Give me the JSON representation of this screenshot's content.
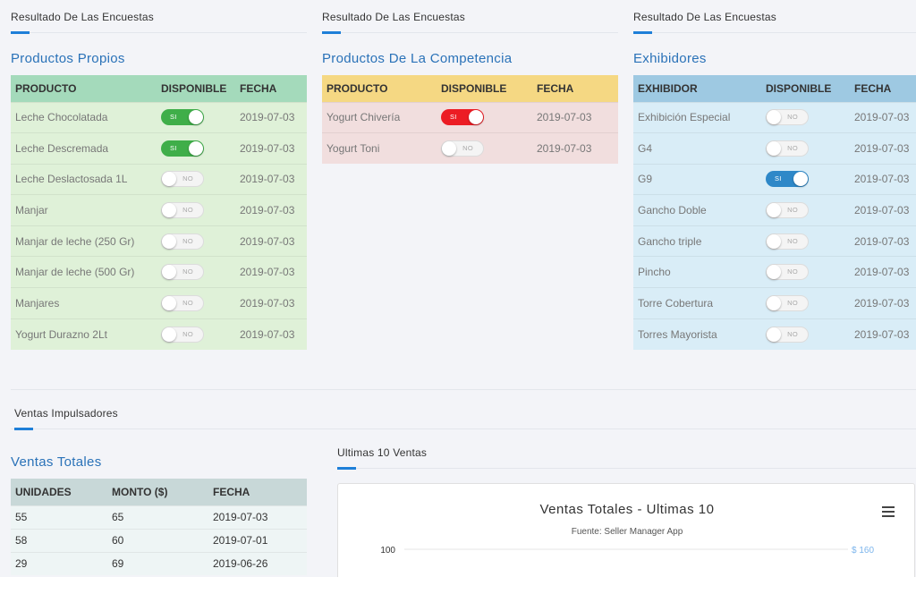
{
  "surveys": [
    {
      "section_title": "Resultado De Las Encuestas",
      "panel_title": "Productos Propios",
      "headers": [
        "PRODUCTO",
        "DISPONIBLE",
        "FECHA"
      ],
      "rows": [
        {
          "name": "Leche Chocolatada",
          "available": true,
          "toggle": "SI",
          "date": "2019-07-03"
        },
        {
          "name": "Leche Descremada",
          "available": true,
          "toggle": "SI",
          "date": "2019-07-03"
        },
        {
          "name": "Leche Deslactosada 1L",
          "available": false,
          "toggle": "NO",
          "date": "2019-07-03"
        },
        {
          "name": "Manjar",
          "available": false,
          "toggle": "NO",
          "date": "2019-07-03"
        },
        {
          "name": "Manjar de leche (250 Gr)",
          "available": false,
          "toggle": "NO",
          "date": "2019-07-03"
        },
        {
          "name": "Manjar de leche (500 Gr)",
          "available": false,
          "toggle": "NO",
          "date": "2019-07-03"
        },
        {
          "name": "Manjares",
          "available": false,
          "toggle": "NO",
          "date": "2019-07-03"
        },
        {
          "name": "Yogurt Durazno 2Lt",
          "available": false,
          "toggle": "NO",
          "date": "2019-07-03"
        }
      ]
    },
    {
      "section_title": "Resultado De Las Encuestas",
      "panel_title": "Productos De La Competencia",
      "headers": [
        "PRODUCTO",
        "DISPONIBLE",
        "FECHA"
      ],
      "rows": [
        {
          "name": "Yogurt Chivería",
          "available": true,
          "toggle": "SI",
          "date": "2019-07-03"
        },
        {
          "name": "Yogurt Toni",
          "available": false,
          "toggle": "NO",
          "date": "2019-07-03"
        }
      ]
    },
    {
      "section_title": "Resultado De Las Encuestas",
      "panel_title": "Exhibidores",
      "headers": [
        "EXHIBIDOR",
        "DISPONIBLE",
        "FECHA"
      ],
      "rows": [
        {
          "name": "Exhibición Especial",
          "available": false,
          "toggle": "NO",
          "date": "2019-07-03"
        },
        {
          "name": "G4",
          "available": false,
          "toggle": "NO",
          "date": "2019-07-03"
        },
        {
          "name": "G9",
          "available": true,
          "toggle": "SI",
          "date": "2019-07-03"
        },
        {
          "name": "Gancho Doble",
          "available": false,
          "toggle": "NO",
          "date": "2019-07-03"
        },
        {
          "name": "Gancho triple",
          "available": false,
          "toggle": "NO",
          "date": "2019-07-03"
        },
        {
          "name": "Pincho",
          "available": false,
          "toggle": "NO",
          "date": "2019-07-03"
        },
        {
          "name": "Torre Cobertura",
          "available": false,
          "toggle": "NO",
          "date": "2019-07-03"
        },
        {
          "name": "Torres Mayorista",
          "available": false,
          "toggle": "NO",
          "date": "2019-07-03"
        }
      ]
    }
  ],
  "sales": {
    "section_title": "Ventas Impulsadores",
    "panel_title": "Ventas Totales",
    "headers": [
      "UNIDADES",
      "MONTO ($)",
      "FECHA"
    ],
    "rows": [
      {
        "units": "55",
        "amount": "65",
        "date": "2019-07-03"
      },
      {
        "units": "58",
        "amount": "60",
        "date": "2019-07-01"
      },
      {
        "units": "29",
        "amount": "69",
        "date": "2019-06-26"
      }
    ]
  },
  "last_sales": {
    "section_title": "Ultimas 10 Ventas",
    "chart_title": "Ventas Totales - Ultimas 10",
    "chart_subtitle": "Fuente: Seller Manager App",
    "chart_data": {
      "type": "line",
      "title": "Ventas Totales - Ultimas 10",
      "subtitle": "Fuente: Seller Manager App",
      "y_left_ticks": [
        100
      ],
      "y_right_ticks": [
        "$ 160"
      ],
      "series": []
    }
  },
  "colors": {
    "accent": "#1e7fd8",
    "title_blue": "#2a72b8",
    "toggle_green": "#3fae49",
    "toggle_red": "#ec1c24",
    "toggle_blue": "#2e88c8",
    "green_header": "#a4dabb",
    "green_row": "#dff1d8",
    "yellow_header": "#f5d883",
    "pink_row": "#f1dede",
    "blue_header": "#9ec9e2",
    "blue_row": "#d9edf7"
  }
}
